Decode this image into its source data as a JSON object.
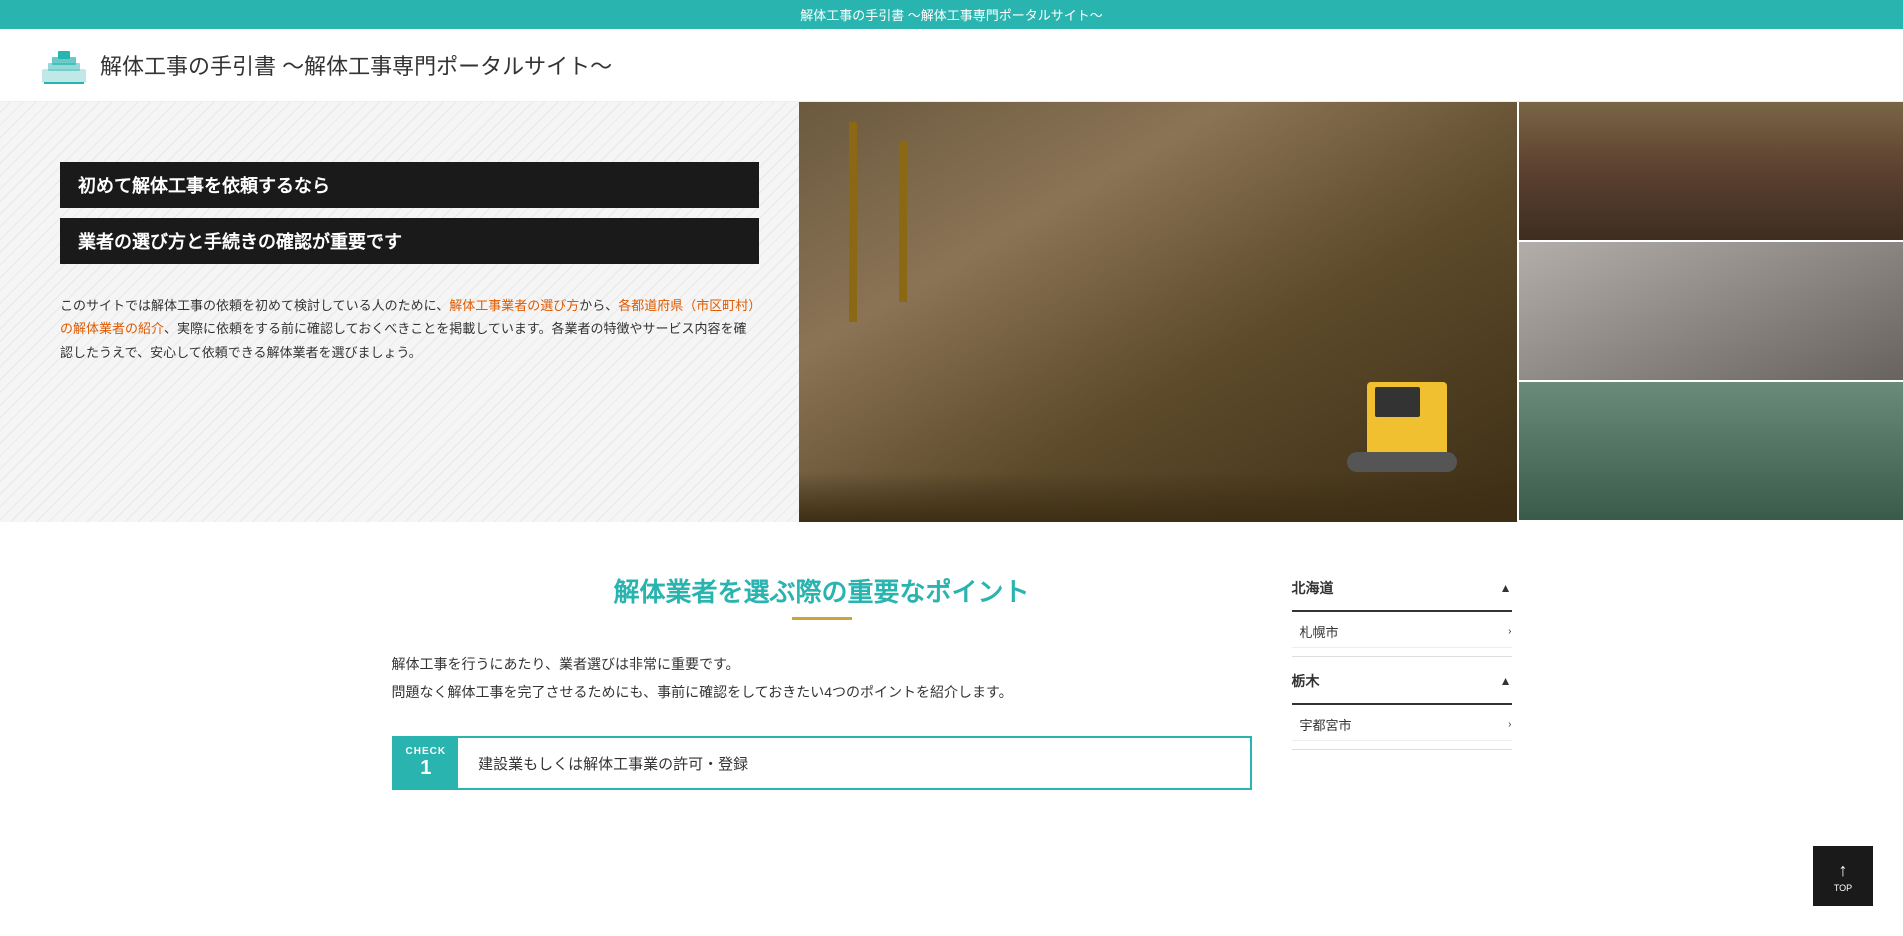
{
  "topBar": {
    "text": "解体工事の手引書 〜解体工事専門ポータルサイト〜"
  },
  "header": {
    "title": "解体工事の手引書 〜解体工事専門ポータルサイト〜"
  },
  "hero": {
    "headline1": "初めて解体工事を依頼するなら",
    "headline2": "業者の選び方と手続きの確認が重要です",
    "body": "このサイトでは解体工事の依頼を初めて検討している人のために、解体工事業者の選び方から、各都道府県（市区町村）の解体業者の紹介、実際に依頼をする前に確認しておくべきことを掲載しています。各業者の特徴やサービス内容を確認したうえで、安心して依頼できる解体業者を選びましょう。",
    "bodyLinkText1": "解体工事業者の選び方",
    "bodyLinkText2": "各都道府県（市区町村）の解体業者の紹介"
  },
  "mainSection": {
    "title": "解体業者を選ぶ際の重要なポイント",
    "desc1": "解体工事を行うにあたり、業者選びは非常に重要です。",
    "desc2": "問題なく解体工事を完了させるためにも、事前に確認をしておきたい4つのポイントを紹介します。",
    "checkLabel": "CHECK",
    "checkNumber": "1",
    "checkItemText": "建設業もしくは解体工事業の許可・登録"
  },
  "sidebar": {
    "regions": [
      {
        "name": "北海道",
        "arrow": "▲",
        "cities": [
          {
            "name": "札幌市",
            "chevron": "›"
          }
        ]
      },
      {
        "name": "栃木",
        "arrow": "▲",
        "cities": [
          {
            "name": "宇都宮市",
            "chevron": "›"
          }
        ]
      }
    ]
  },
  "backToTop": {
    "arrow": "↑",
    "label": "TOP"
  }
}
